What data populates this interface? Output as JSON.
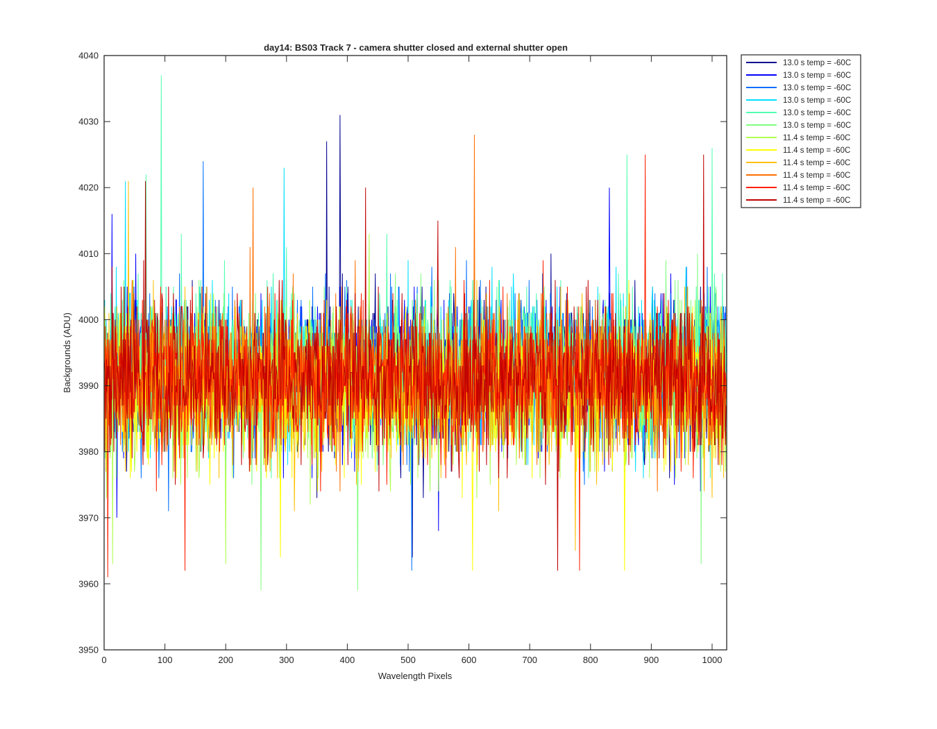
{
  "chart_data": {
    "type": "line",
    "title": "day14: BS03  Track 7 - camera shutter closed and external shutter open",
    "xlabel": "Wavelength Pixels",
    "ylabel": "Backgrounds (ADU)",
    "xlim": [
      0,
      1024
    ],
    "ylim": [
      3950,
      4040
    ],
    "xticks": [
      0,
      100,
      200,
      300,
      400,
      500,
      600,
      700,
      800,
      900,
      1000
    ],
    "yticks": [
      3950,
      3960,
      3970,
      3980,
      3990,
      4000,
      4010,
      4020,
      4030,
      4040
    ],
    "x_tick_labels": [
      "0",
      "100",
      "200",
      "300",
      "400",
      "500",
      "600",
      "700",
      "800",
      "900",
      "1000"
    ],
    "y_tick_labels": [
      "3950",
      "3960",
      "3970",
      "3980",
      "3990",
      "4000",
      "4010",
      "4020",
      "4030",
      "4040"
    ],
    "grid": false,
    "legend_position": "outside-top-right",
    "n_points": 1024,
    "series_mean": 3991,
    "series": [
      {
        "name": "13.0 s temp = -60C",
        "color": "#000090",
        "mean": 3992,
        "spread": 9,
        "spikes": [
          [
            388,
            4031
          ],
          [
            366,
            4027
          ],
          [
            507,
            3964
          ]
        ]
      },
      {
        "name": "13.0 s temp = -60C",
        "color": "#0000ff",
        "mean": 3992,
        "spread": 9,
        "spikes": [
          [
            13,
            4016
          ],
          [
            550,
            3968
          ],
          [
            831,
            4020
          ]
        ]
      },
      {
        "name": "13.0 s temp = -60C",
        "color": "#006fff",
        "mean": 3992,
        "spread": 9,
        "spikes": [
          [
            506,
            3962
          ],
          [
            163,
            4024
          ]
        ]
      },
      {
        "name": "13.0 s temp = -60C",
        "color": "#00dfff",
        "mean": 3993,
        "spread": 9,
        "spikes": [
          [
            35,
            4021
          ],
          [
            296,
            4023
          ]
        ]
      },
      {
        "name": "13.0 s temp = -60C",
        "color": "#4fffaf",
        "mean": 3993,
        "spread": 9,
        "spikes": [
          [
            94,
            4037
          ],
          [
            69,
            4022
          ],
          [
            1000,
            4026
          ],
          [
            860,
            4025
          ]
        ]
      },
      {
        "name": "13.0 s temp = -60C",
        "color": "#80ff80",
        "mean": 3992,
        "spread": 9,
        "spikes": [
          [
            258,
            3959
          ],
          [
            417,
            3959
          ],
          [
            982,
            3963
          ]
        ]
      },
      {
        "name": "11.4 s temp = -60C",
        "color": "#b0ff4f",
        "mean": 3989,
        "spread": 9,
        "spikes": [
          [
            14,
            3963
          ],
          [
            200,
            3963
          ]
        ]
      },
      {
        "name": "11.4 s temp = -60C",
        "color": "#ffff00",
        "mean": 3989,
        "spread": 9,
        "spikes": [
          [
            606,
            3962
          ],
          [
            856,
            3962
          ],
          [
            290,
            3964
          ]
        ]
      },
      {
        "name": "11.4 s temp = -60C",
        "color": "#ffbf00",
        "mean": 3990,
        "spread": 9,
        "spikes": [
          [
            775,
            3965
          ],
          [
            40,
            4021
          ]
        ]
      },
      {
        "name": "11.4 s temp = -60C",
        "color": "#ff6f00",
        "mean": 3991,
        "spread": 9,
        "spikes": [
          [
            609,
            4028
          ],
          [
            245,
            4020
          ]
        ]
      },
      {
        "name": "11.4 s temp = -60C",
        "color": "#ff1f00",
        "mean": 3991,
        "spread": 9,
        "spikes": [
          [
            133,
            3962
          ],
          [
            6,
            3961
          ],
          [
            782,
            3962
          ],
          [
            890,
            4025
          ]
        ]
      },
      {
        "name": "11.4 s temp = -60C",
        "color": "#c00000",
        "mean": 3991,
        "spread": 9,
        "spikes": [
          [
            746,
            3962
          ],
          [
            68,
            4021
          ],
          [
            986,
            4025
          ],
          [
            430,
            4020
          ]
        ]
      }
    ]
  }
}
